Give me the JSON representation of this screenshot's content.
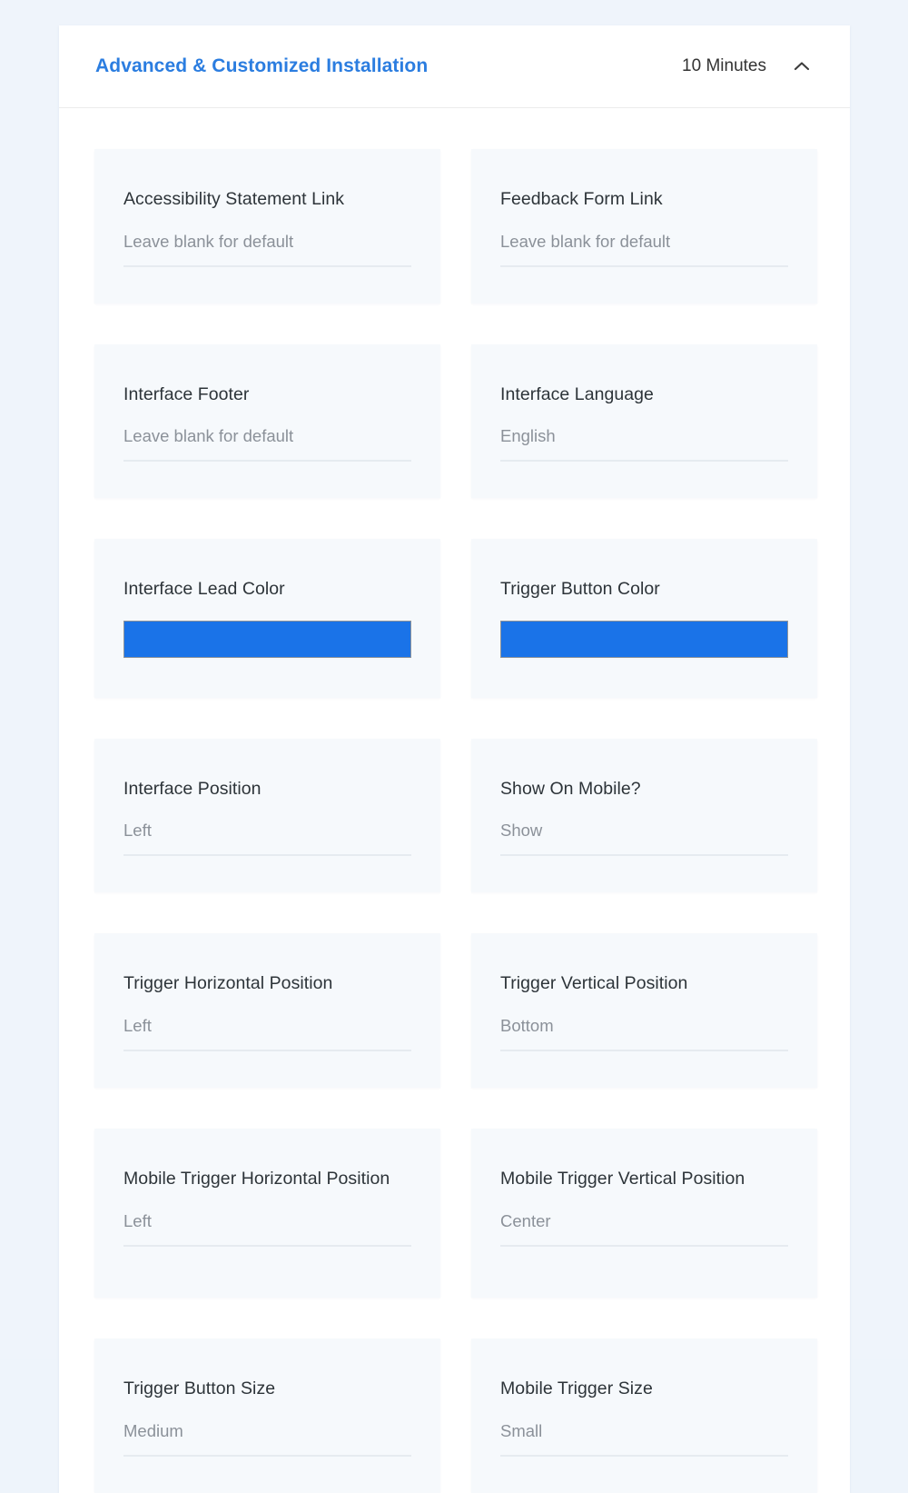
{
  "section": {
    "title": "Advanced & Customized Installation",
    "duration": "10 Minutes",
    "collapse_icon": "chevron-up-icon"
  },
  "colors": {
    "title_blue": "#2b7de0",
    "swatch_blue": "#1a73e8",
    "page_background": "#eff4fb",
    "card_background": "#f6f9fc",
    "label_text": "#2d3439",
    "value_text": "#8b9199"
  },
  "fields": [
    {
      "label": "Accessibility Statement Link",
      "type": "text",
      "value": "",
      "placeholder": "Leave blank for default"
    },
    {
      "label": "Feedback Form Link",
      "type": "text",
      "value": "",
      "placeholder": "Leave blank for default"
    },
    {
      "label": "Interface Footer",
      "type": "text",
      "value": "",
      "placeholder": "Leave blank for default"
    },
    {
      "label": "Interface Language",
      "type": "select",
      "value": "English",
      "placeholder": ""
    },
    {
      "label": "Interface Lead Color",
      "type": "color",
      "value": "#1a73e8",
      "placeholder": ""
    },
    {
      "label": "Trigger Button Color",
      "type": "color",
      "value": "#1a73e8",
      "placeholder": ""
    },
    {
      "label": "Interface Position",
      "type": "select",
      "value": "Left",
      "placeholder": ""
    },
    {
      "label": "Show On Mobile?",
      "type": "select",
      "value": "Show",
      "placeholder": ""
    },
    {
      "label": "Trigger Horizontal Position",
      "type": "select",
      "value": "Left",
      "placeholder": ""
    },
    {
      "label": "Trigger Vertical Position",
      "type": "select",
      "value": "Bottom",
      "placeholder": ""
    },
    {
      "label": "Mobile Trigger Horizontal Position",
      "type": "select",
      "value": "Left",
      "placeholder": ""
    },
    {
      "label": "Mobile Trigger Vertical Position",
      "type": "select",
      "value": "Center",
      "placeholder": ""
    },
    {
      "label": "Trigger Button Size",
      "type": "select",
      "value": "Medium",
      "placeholder": ""
    },
    {
      "label": "Mobile Trigger Size",
      "type": "select",
      "value": "Small",
      "placeholder": ""
    }
  ]
}
